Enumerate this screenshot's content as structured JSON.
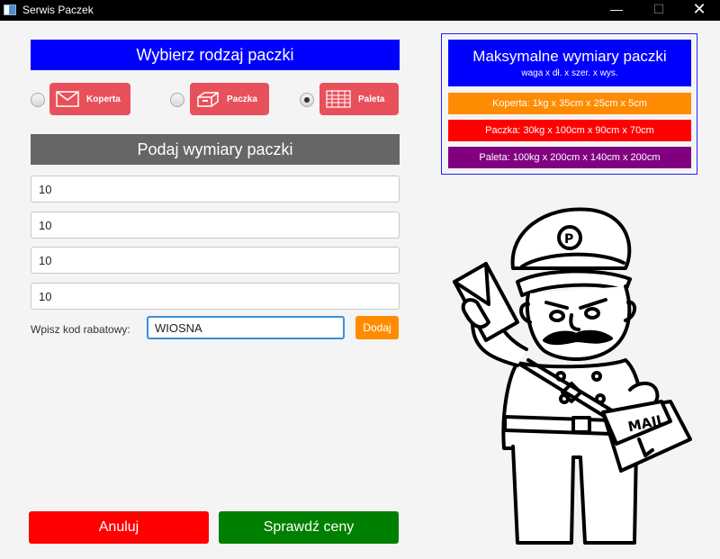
{
  "window": {
    "title": "Serwis Paczek",
    "min": "—",
    "max": "☐",
    "close": "✕"
  },
  "select_header": "Wybierz rodzaj paczki",
  "package_types": [
    {
      "label": "Koperta",
      "icon": "envelope-icon",
      "selected": false
    },
    {
      "label": "Paczka",
      "icon": "box-icon",
      "selected": false
    },
    {
      "label": "Paleta",
      "icon": "pallet-icon",
      "selected": true
    }
  ],
  "dimensions_header": "Podaj wymiary paczki",
  "dimension_fields": [
    "10",
    "10",
    "10",
    "10"
  ],
  "discount": {
    "label": "Wpisz kod rabatowy:",
    "value": "WIOSNA",
    "add_label": "Dodaj"
  },
  "actions": {
    "cancel": "Anuluj",
    "check": "Sprawdź ceny"
  },
  "limits": {
    "title": "Maksymalne wymiary paczki",
    "subtitle": "waga x dł. x szer. x wys.",
    "rows": [
      "Koperta: 1kg x 35cm x 25cm x 5cm",
      "Paczka: 30kg x 100cm x 90cm x 70cm",
      "Paleta: 100kg x 200cm x 140cm x 200cm"
    ]
  },
  "mascot": {
    "bag_text": "MAIL"
  },
  "colors": {
    "blue": "#0000ff",
    "gray": "#666666",
    "type_button": "#e8505b",
    "orange": "#ff8c00",
    "red": "#ff0000",
    "purple": "#800080",
    "green": "#008000"
  }
}
